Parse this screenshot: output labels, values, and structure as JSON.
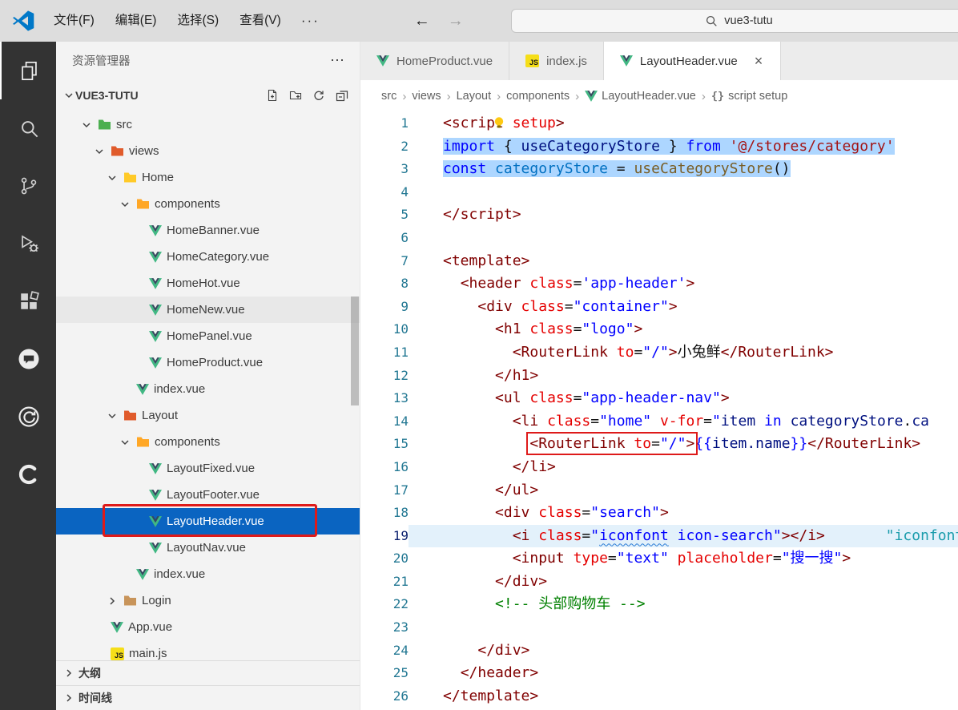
{
  "titlebar": {
    "menus": [
      "文件(F)",
      "编辑(E)",
      "选择(S)",
      "查看(V)"
    ],
    "more_label": "···",
    "back_arrow": "←",
    "forward_arrow": "→",
    "search_value": "vue3-tutu"
  },
  "activity_bar": {
    "icons": [
      "explorer-icon",
      "search-icon",
      "source-control-icon",
      "run-debug-icon",
      "extensions-icon",
      "chat-icon",
      "refresh-circle-icon",
      "c-ring-icon"
    ]
  },
  "sidebar": {
    "title": "资源管理器",
    "more_label": "⋯",
    "project": {
      "name": "VUE3-TUTU"
    },
    "action_icons": [
      "new-file-icon",
      "new-folder-icon",
      "refresh-icon",
      "collapse-all-icon"
    ],
    "tree": [
      {
        "label": "src",
        "kind": "folder",
        "level": 1,
        "chevron": "down",
        "color": "#4caf50"
      },
      {
        "label": "views",
        "kind": "folder",
        "level": 2,
        "chevron": "down",
        "color": "#e05b2b"
      },
      {
        "label": "Home",
        "kind": "folder",
        "level": 3,
        "chevron": "down",
        "color": "#ffca28"
      },
      {
        "label": "components",
        "kind": "folder",
        "level": 4,
        "chevron": "down",
        "color": "#ffa726"
      },
      {
        "label": "HomeBanner.vue",
        "kind": "vue",
        "level": 5
      },
      {
        "label": "HomeCategory.vue",
        "kind": "vue",
        "level": 5
      },
      {
        "label": "HomeHot.vue",
        "kind": "vue",
        "level": 5
      },
      {
        "label": "HomeNew.vue",
        "kind": "vue",
        "level": 5,
        "state": "hover"
      },
      {
        "label": "HomePanel.vue",
        "kind": "vue",
        "level": 5
      },
      {
        "label": "HomeProduct.vue",
        "kind": "vue",
        "level": 5
      },
      {
        "label": "index.vue",
        "kind": "vue",
        "level": 4
      },
      {
        "label": "Layout",
        "kind": "folder",
        "level": 3,
        "chevron": "down",
        "color": "#e05b2b"
      },
      {
        "label": "components",
        "kind": "folder",
        "level": 4,
        "chevron": "down",
        "color": "#ffa726"
      },
      {
        "label": "LayoutFixed.vue",
        "kind": "vue",
        "level": 5
      },
      {
        "label": "LayoutFooter.vue",
        "kind": "vue",
        "level": 5
      },
      {
        "label": "LayoutHeader.vue",
        "kind": "vue",
        "level": 5,
        "state": "selected",
        "annotated": true
      },
      {
        "label": "LayoutNav.vue",
        "kind": "vue",
        "level": 5
      },
      {
        "label": "index.vue",
        "kind": "vue",
        "level": 4
      },
      {
        "label": "Login",
        "kind": "folder",
        "level": 3,
        "chevron": "right",
        "color": "#c8945a"
      },
      {
        "label": "App.vue",
        "kind": "vue",
        "level": 2
      },
      {
        "label": "main.js",
        "kind": "js",
        "level": 2
      }
    ],
    "sections": [
      {
        "label": "大纲"
      },
      {
        "label": "时间线"
      }
    ]
  },
  "tabs": [
    {
      "label": "HomeProduct.vue",
      "icon": "vue",
      "active": false
    },
    {
      "label": "index.js",
      "icon": "js",
      "active": false
    },
    {
      "label": "LayoutHeader.vue",
      "icon": "vue",
      "active": true,
      "close": "×"
    }
  ],
  "breadcrumb": {
    "separator": "›",
    "items": [
      {
        "label": "src"
      },
      {
        "label": "views"
      },
      {
        "label": "Layout"
      },
      {
        "label": "components"
      },
      {
        "label": "LayoutHeader.vue",
        "icon": "vue"
      },
      {
        "label": "script setup",
        "icon": "braces"
      }
    ]
  },
  "editor": {
    "lines": [
      {
        "n": 1,
        "indent": 0,
        "tokens": [
          {
            "t": "<script ",
            "c": "tag"
          },
          {
            "t": "setup",
            "c": "attr"
          },
          {
            "t": ">",
            "c": "tag"
          }
        ]
      },
      {
        "n": 2,
        "indent": 0,
        "sel": true,
        "tokens": [
          {
            "t": "import ",
            "c": "kw"
          },
          {
            "t": "{ ",
            "c": "p"
          },
          {
            "t": "useCategoryStore",
            "c": "var"
          },
          {
            "t": " } ",
            "c": "p"
          },
          {
            "t": "from ",
            "c": "kw"
          },
          {
            "t": "'@/stores/category'",
            "c": "jstr"
          }
        ]
      },
      {
        "n": 3,
        "indent": 0,
        "sel": true,
        "tokens": [
          {
            "t": "const ",
            "c": "kw"
          },
          {
            "t": "categoryStore",
            "c": "cvar"
          },
          {
            "t": " = ",
            "c": "p"
          },
          {
            "t": "useCategoryStore",
            "c": "fn"
          },
          {
            "t": "()",
            "c": "p"
          }
        ]
      },
      {
        "n": 4,
        "indent": 0,
        "tokens": []
      },
      {
        "n": 5,
        "indent": 0,
        "tokens": [
          {
            "t": "</script>",
            "c": "tag"
          }
        ]
      },
      {
        "n": 6,
        "indent": 0,
        "tokens": []
      },
      {
        "n": 7,
        "indent": 0,
        "tokens": [
          {
            "t": "<template>",
            "c": "tag"
          }
        ]
      },
      {
        "n": 8,
        "indent": 2,
        "tokens": [
          {
            "t": "<header ",
            "c": "tag"
          },
          {
            "t": "class",
            "c": "attr"
          },
          {
            "t": "=",
            "c": "p"
          },
          {
            "t": "'app-header'",
            "c": "str"
          },
          {
            "t": ">",
            "c": "tag"
          }
        ]
      },
      {
        "n": 9,
        "indent": 4,
        "tokens": [
          {
            "t": "<div ",
            "c": "tag"
          },
          {
            "t": "class",
            "c": "attr"
          },
          {
            "t": "=",
            "c": "p"
          },
          {
            "t": "\"container\"",
            "c": "str"
          },
          {
            "t": ">",
            "c": "tag"
          }
        ]
      },
      {
        "n": 10,
        "indent": 6,
        "tokens": [
          {
            "t": "<h1 ",
            "c": "tag"
          },
          {
            "t": "class",
            "c": "attr"
          },
          {
            "t": "=",
            "c": "p"
          },
          {
            "t": "\"logo\"",
            "c": "str"
          },
          {
            "t": ">",
            "c": "tag"
          }
        ]
      },
      {
        "n": 11,
        "indent": 8,
        "tokens": [
          {
            "t": "<RouterLink ",
            "c": "tag"
          },
          {
            "t": "to",
            "c": "attr"
          },
          {
            "t": "=",
            "c": "p"
          },
          {
            "t": "\"/\"",
            "c": "str"
          },
          {
            "t": ">",
            "c": "tag"
          },
          {
            "t": "小兔鲜",
            "c": "txt"
          },
          {
            "t": "</RouterLink>",
            "c": "tag"
          }
        ]
      },
      {
        "n": 12,
        "indent": 6,
        "tokens": [
          {
            "t": "</h1>",
            "c": "tag"
          }
        ]
      },
      {
        "n": 13,
        "indent": 6,
        "tokens": [
          {
            "t": "<ul ",
            "c": "tag"
          },
          {
            "t": "class",
            "c": "attr"
          },
          {
            "t": "=",
            "c": "p"
          },
          {
            "t": "\"app-header-nav\"",
            "c": "str"
          },
          {
            "t": ">",
            "c": "tag"
          }
        ]
      },
      {
        "n": 14,
        "indent": 8,
        "tokens": [
          {
            "t": "<li ",
            "c": "tag"
          },
          {
            "t": "class",
            "c": "attr"
          },
          {
            "t": "=",
            "c": "p"
          },
          {
            "t": "\"home\"",
            "c": "str"
          },
          {
            "t": " ",
            "c": "p"
          },
          {
            "t": "v-for",
            "c": "attr"
          },
          {
            "t": "=",
            "c": "p"
          },
          {
            "t": "\"",
            "c": "str"
          },
          {
            "t": "item",
            "c": "var"
          },
          {
            "t": " ",
            "c": "p"
          },
          {
            "t": "in",
            "c": "kw"
          },
          {
            "t": " ",
            "c": "p"
          },
          {
            "t": "categoryStore",
            "c": "var"
          },
          {
            "t": ".",
            "c": "p"
          },
          {
            "t": "ca",
            "c": "var"
          }
        ]
      },
      {
        "n": 15,
        "indent": 10,
        "tokens": [
          {
            "t": "<RouterLink ",
            "c": "tag",
            "b": 1
          },
          {
            "t": "to",
            "c": "attr",
            "b": 1
          },
          {
            "t": "=",
            "c": "p",
            "b": 1
          },
          {
            "t": "\"/\"",
            "c": "str",
            "b": 1
          },
          {
            "t": ">",
            "c": "tag",
            "b": 1
          },
          {
            "t": "{{",
            "c": "kw"
          },
          {
            "t": "item.name",
            "c": "var"
          },
          {
            "t": "}}",
            "c": "kw"
          },
          {
            "t": "</RouterLink>",
            "c": "tag"
          }
        ]
      },
      {
        "n": 16,
        "indent": 8,
        "tokens": [
          {
            "t": "</li>",
            "c": "tag"
          }
        ]
      },
      {
        "n": 17,
        "indent": 6,
        "tokens": [
          {
            "t": "</ul>",
            "c": "tag"
          }
        ]
      },
      {
        "n": 18,
        "indent": 6,
        "tokens": [
          {
            "t": "<div ",
            "c": "tag"
          },
          {
            "t": "class",
            "c": "attr"
          },
          {
            "t": "=",
            "c": "p"
          },
          {
            "t": "\"search\"",
            "c": "str"
          },
          {
            "t": ">",
            "c": "tag"
          }
        ]
      },
      {
        "n": 19,
        "indent": 8,
        "current": true,
        "tokens": [
          {
            "t": "<i ",
            "c": "tag"
          },
          {
            "t": "class",
            "c": "attr"
          },
          {
            "t": "=",
            "c": "p"
          },
          {
            "t": "\"",
            "c": "str"
          },
          {
            "t": "iconfont",
            "c": "str",
            "sq": 1
          },
          {
            "t": " icon-search\"",
            "c": "str"
          },
          {
            "t": "></i>",
            "c": "tag"
          },
          {
            "t": "       ",
            "c": "p"
          },
          {
            "t": "\"iconfont",
            "c": "ghost"
          }
        ]
      },
      {
        "n": 20,
        "indent": 8,
        "tokens": [
          {
            "t": "<input ",
            "c": "tag"
          },
          {
            "t": "type",
            "c": "attr"
          },
          {
            "t": "=",
            "c": "p"
          },
          {
            "t": "\"text\"",
            "c": "str"
          },
          {
            "t": " ",
            "c": "p"
          },
          {
            "t": "placeholder",
            "c": "attr"
          },
          {
            "t": "=",
            "c": "p"
          },
          {
            "t": "\"搜一搜\"",
            "c": "str"
          },
          {
            "t": ">",
            "c": "tag"
          }
        ]
      },
      {
        "n": 21,
        "indent": 6,
        "tokens": [
          {
            "t": "</div>",
            "c": "tag"
          }
        ]
      },
      {
        "n": 22,
        "indent": 6,
        "tokens": [
          {
            "t": "<!-- 头部购物车 -->",
            "c": "cmt"
          }
        ]
      },
      {
        "n": 23,
        "indent": 0,
        "tokens": []
      },
      {
        "n": 24,
        "indent": 4,
        "tokens": [
          {
            "t": "</div>",
            "c": "tag"
          }
        ]
      },
      {
        "n": 25,
        "indent": 2,
        "tokens": [
          {
            "t": "</header>",
            "c": "tag"
          }
        ]
      },
      {
        "n": 26,
        "indent": 0,
        "tokens": [
          {
            "t": "</template>",
            "c": "tag"
          }
        ]
      }
    ]
  }
}
